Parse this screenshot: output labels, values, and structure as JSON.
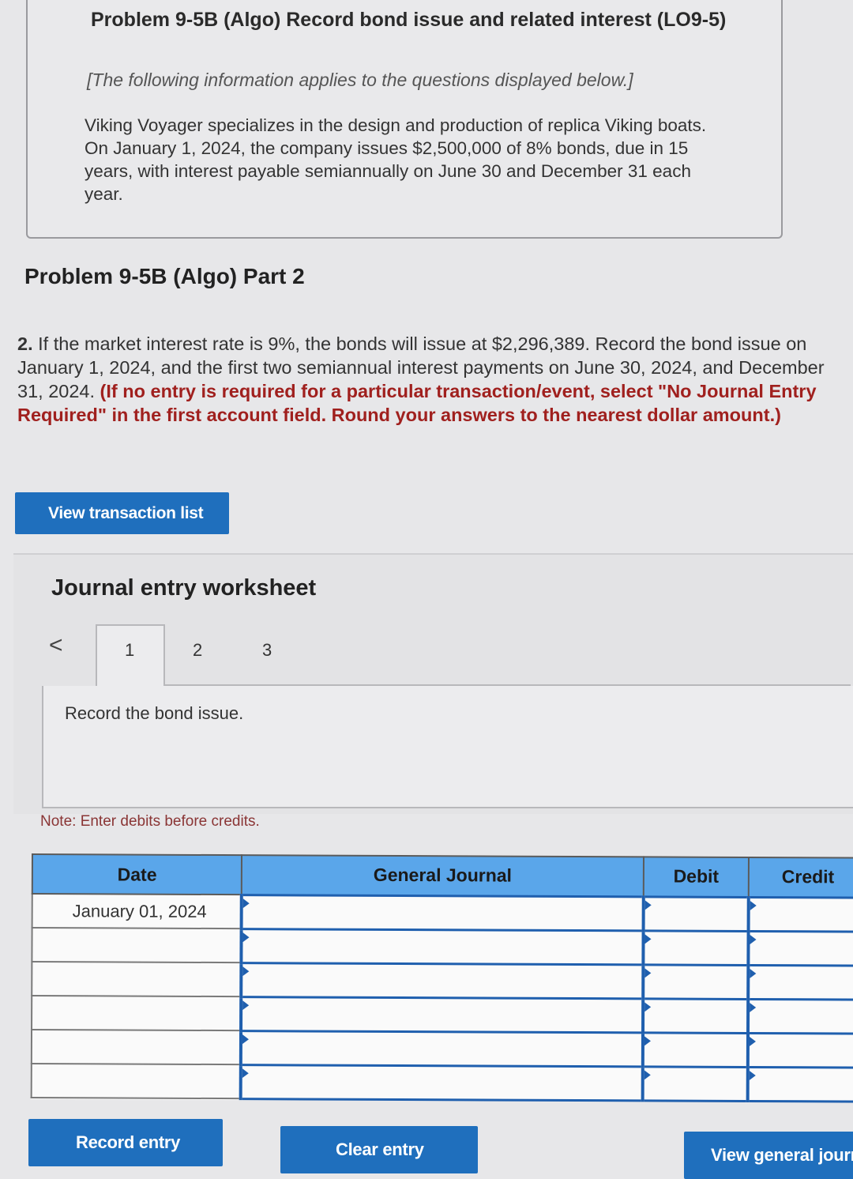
{
  "info": {
    "title": "Problem 9-5B (Algo) Record bond issue and related interest (LO9-5)",
    "applies": "[The following information applies to the questions displayed below.]",
    "body": "Viking Voyager specializes in the design and production of replica Viking boats. On January 1, 2024, the company issues $2,500,000 of 8% bonds, due in 15 years, with interest payable semiannually on June 30 and December 31 each year."
  },
  "part": {
    "title": "Problem 9-5B (Algo) Part 2"
  },
  "question": {
    "number": "2.",
    "text": " If the market interest rate is 9%, the bonds will issue at $2,296,389. Record the bond issue on January 1, 2024, and the first two semiannual interest payments on June 30, 2024, and December 31, 2024. ",
    "instruction": "(If no entry is required for a particular transaction/event, select \"No Journal Entry Required\" in the first account field. Round your answers to the nearest dollar amount.)"
  },
  "buttons": {
    "view_transactions": "View transaction list",
    "record_entry": "Record entry",
    "clear_entry": "Clear entry",
    "view_general_journal": "View general journ"
  },
  "worksheet": {
    "title": "Journal entry worksheet",
    "prev_glyph": "<",
    "tabs": [
      "1",
      "2",
      "3"
    ],
    "active_tab": 0,
    "entry_description": "Record the bond issue.",
    "note": "Note: Enter debits before credits."
  },
  "journal": {
    "headers": {
      "date": "Date",
      "account": "General Journal",
      "debit": "Debit",
      "credit": "Credit"
    },
    "rows": [
      {
        "date": "January 01, 2024",
        "account": "",
        "debit": "",
        "credit": ""
      },
      {
        "date": "",
        "account": "",
        "debit": "",
        "credit": ""
      },
      {
        "date": "",
        "account": "",
        "debit": "",
        "credit": ""
      },
      {
        "date": "",
        "account": "",
        "debit": "",
        "credit": ""
      },
      {
        "date": "",
        "account": "",
        "debit": "",
        "credit": ""
      },
      {
        "date": "",
        "account": "",
        "debit": "",
        "credit": ""
      }
    ]
  },
  "colors": {
    "button_blue": "#1f6fbd",
    "header_blue": "#5aa6ea",
    "instruction_red": "#a0201e"
  }
}
